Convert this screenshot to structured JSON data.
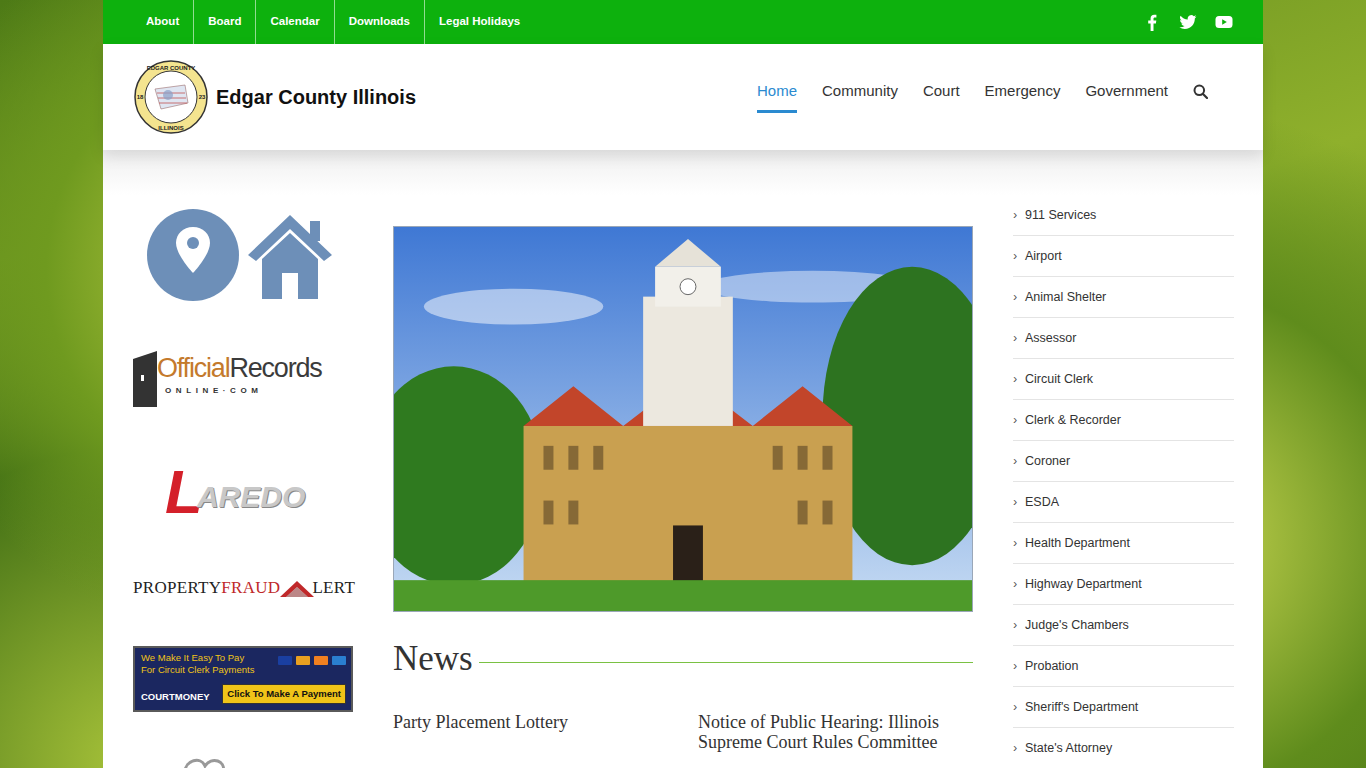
{
  "topbar": {
    "links": [
      "About",
      "Board",
      "Calendar",
      "Downloads",
      "Legal Holidays"
    ]
  },
  "site": {
    "title": "Edgar County Illinois",
    "seal": {
      "top": "EDGAR COUNTY",
      "bottom": "ILLINOIS",
      "left": "18",
      "right": "23"
    }
  },
  "nav": [
    {
      "label": "Home",
      "selected": true
    },
    {
      "label": "Community",
      "selected": false
    },
    {
      "label": "Court",
      "selected": false
    },
    {
      "label": "Emergency",
      "selected": false
    },
    {
      "label": "Government",
      "selected": false
    }
  ],
  "left_logos": {
    "official_records": {
      "first": "Official",
      "second": "Records",
      "domain": "ONLINE·COM"
    },
    "laredo": {
      "first": "L",
      "rest": "AREDO"
    },
    "property_fraud_alert": {
      "first": "PROPERTY",
      "second": "FRAUD",
      "third": "LERT"
    },
    "courtmoney": {
      "line1": "We Make It Easy To Pay",
      "line2": "For Circuit Clerk Payments",
      "brand": "COURTMONEY",
      "button": "Click To Make A Payment"
    }
  },
  "news": {
    "heading": "News",
    "items": [
      "Party Placement Lottery",
      "Notice of Public Hearing: Illinois Supreme Court Rules Committee"
    ]
  },
  "sidebar": {
    "bullet": "›",
    "items": [
      "911 Services",
      "Airport",
      "Animal Shelter",
      "Assessor",
      "Circuit Clerk",
      "Clerk & Recorder",
      "Coroner",
      "ESDA",
      "Health Department",
      "Highway Department",
      "Judge's Chambers",
      "Probation",
      "Sheriff's Department",
      "State's Attorney"
    ]
  }
}
